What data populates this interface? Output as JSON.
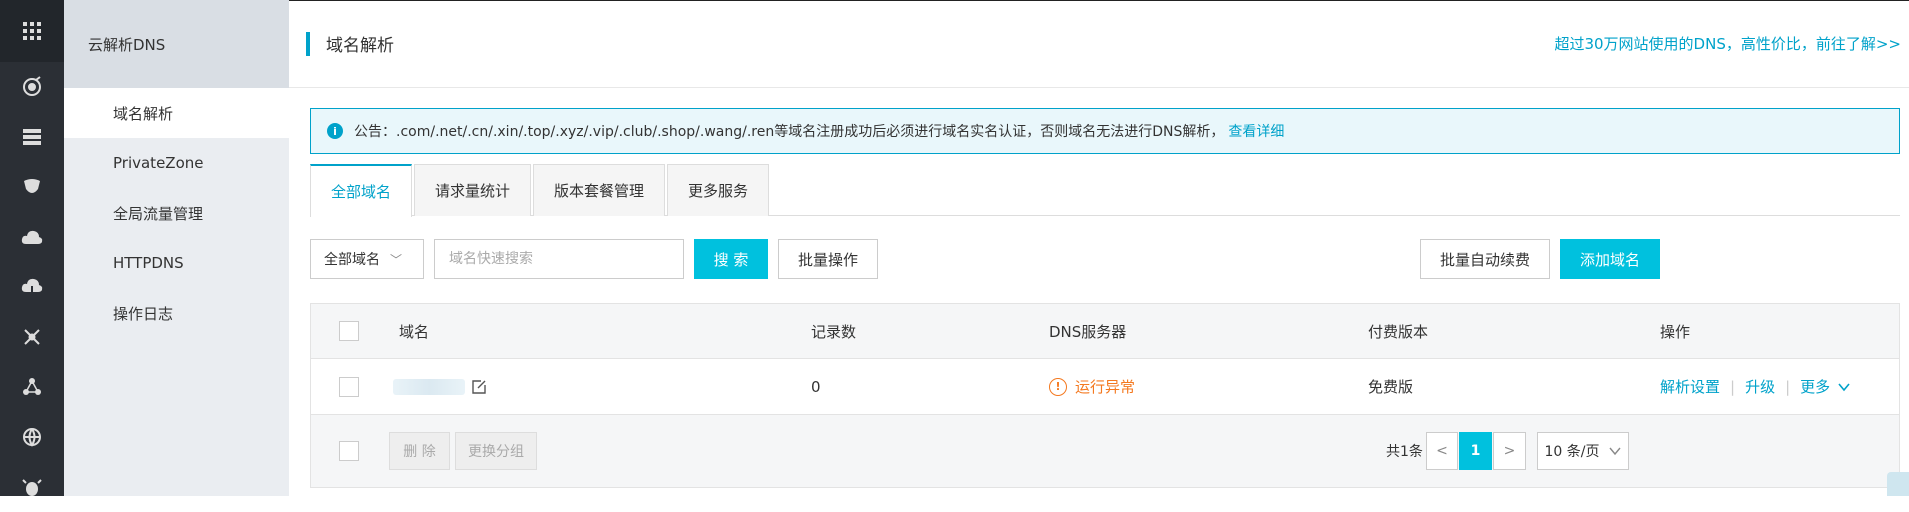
{
  "rail": {
    "icons": [
      "grid-icon",
      "dns-icon",
      "server-icon",
      "shield-icon",
      "cloud-upload-icon",
      "cloud-download-icon",
      "network-icon",
      "nodes-icon",
      "globe-icon",
      "bug-icon"
    ]
  },
  "sidebar": {
    "title": "云解析DNS",
    "items": [
      {
        "label": "域名解析"
      },
      {
        "label": "PrivateZone"
      },
      {
        "label": "全局流量管理"
      },
      {
        "label": "HTTPDNS"
      },
      {
        "label": "操作日志"
      }
    ]
  },
  "header": {
    "title": "域名解析",
    "promo": "超过30万网站使用的DNS，高性价比，前往了解>>"
  },
  "notice": {
    "icon": "i",
    "text": "公告：.com/.net/.cn/.xin/.top/.xyz/.vip/.club/.shop/.wang/.ren等域名注册成功后必须进行域名实名认证，否则域名无法进行DNS解析，",
    "link": "查看详细"
  },
  "tabs": [
    {
      "label": "全部域名"
    },
    {
      "label": "请求量统计"
    },
    {
      "label": "版本套餐管理"
    },
    {
      "label": "更多服务"
    }
  ],
  "toolbar": {
    "filter_value": "全部域名",
    "search_placeholder": "域名快速搜索",
    "search_label": "搜 索",
    "batch_label": "批量操作",
    "auto_renew_label": "批量自动续费",
    "add_domain_label": "添加域名"
  },
  "table": {
    "columns": [
      "域名",
      "记录数",
      "DNS服务器",
      "付费版本",
      "操作"
    ],
    "rows": [
      {
        "records": "0",
        "dns_status": "运行异常",
        "dns_status_icon": "!",
        "plan": "免费版",
        "actions": [
          "解析设置",
          "升级",
          "更多"
        ]
      }
    ]
  },
  "footer": {
    "delete_label": "删 除",
    "change_group_label": "更换分组",
    "total": "共1条",
    "prev": "<",
    "current_page": "1",
    "next": ">",
    "page_size": "10 条/页"
  },
  "colors": {
    "accent": "#00a2ca",
    "primary_button": "#00c1de",
    "warning": "#f47920",
    "rail": "#2b2f35"
  }
}
